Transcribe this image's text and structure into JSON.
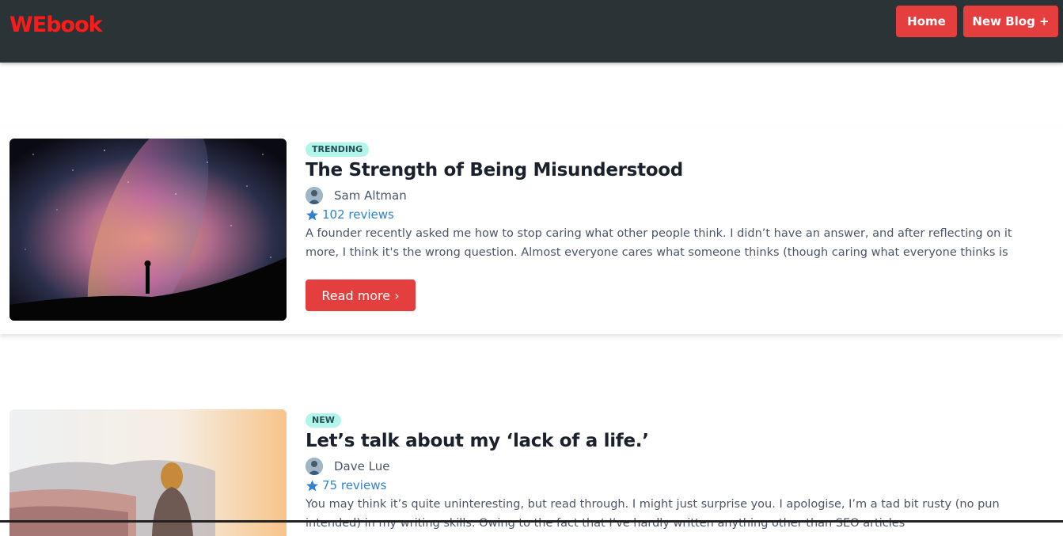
{
  "nav": {
    "brand": "WEbook",
    "home_label": "Home",
    "new_blog_label": "New Blog +"
  },
  "posts": [
    {
      "badge": "TRENDING",
      "title": "The Strength of Being Misunderstood",
      "author": "Sam Altman",
      "reviews": "102 reviews",
      "excerpt": "A founder recently asked me how to stop caring what other people think. I didn’t have an answer, and after reflecting on it more, I think it's the wrong question. Almost everyone cares what someone thinks (though caring what everyone thinks is",
      "read_more": "Read more ›"
    },
    {
      "badge": "NEW",
      "title": "Let’s talk about my ‘lack of a life.’",
      "author": "Dave Lue",
      "reviews": "75 reviews",
      "excerpt": "You may think it’s quite uninteresting, but read through. I might just surprise you. I apologise, I’m a tad bit rusty (no pun intended) in my writing skills. Owing to the fact that I’ve hardly written anything other than SEO articles"
    }
  ],
  "colors": {
    "navbar": "#2a3436",
    "brand": "#ff1a1a",
    "accent": "#e53e3e",
    "badge_bg": "#b2f5ea",
    "link": "#3182ce"
  },
  "icons": [
    "star-icon",
    "avatar"
  ]
}
